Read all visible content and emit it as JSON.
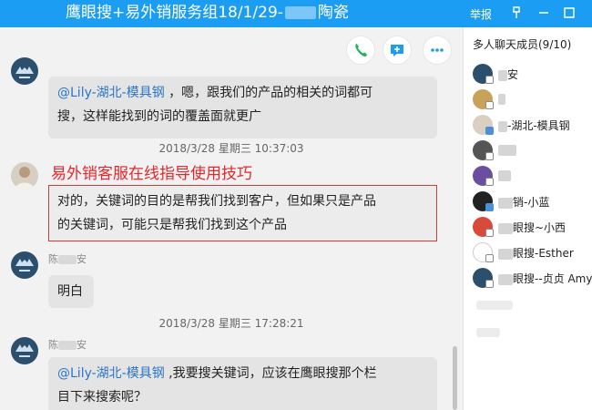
{
  "titlebar": {
    "title_prefix": "鹰眼搜+易外销服务组18/1/29-",
    "title_suffix": "陶瓷",
    "report": "举报",
    "pin_icon": "pin-icon",
    "minimize_icon": "minimize-icon",
    "maximize_icon": "maximize-icon"
  },
  "toolbar": {
    "call_icon": "phone-icon",
    "chat_icon": "chat-add-icon",
    "more_icon": "more-icon",
    "accent": "#1a9df2"
  },
  "messages": [
    {
      "mention": "@Lily-湖北-模具钢",
      "line1": " ，嗯，跟我们的产品的相关的词都可",
      "line2": "搜，这样能找到的词的覆盖面就更广"
    },
    {
      "timestamp": "2018/3/28 星期三 10:37:03"
    },
    {
      "caption": "易外销客服在线指导使用技巧",
      "line1": "对的，关键词的目的是帮我们找到客户，但如果只是产品",
      "line2": "的关键词，可能只是帮我们找到这个产品"
    },
    {
      "sender_prefix": "陈",
      "sender_suffix": "安",
      "text": "明白"
    },
    {
      "timestamp": "2018/3/28 星期三 17:28:21"
    },
    {
      "sender_prefix": "陈",
      "sender_suffix": "安",
      "mention": "@Lily-湖北-模具钢",
      "line1": " ,我要搜关键词，应该在鹰眼搜那个栏",
      "line2": "目下来搜索呢？"
    }
  ],
  "sidebar": {
    "title": "多人聊天成员(9/10)",
    "members": [
      {
        "name": "安"
      },
      {
        "name": ""
      },
      {
        "name": "-湖北-模具钢"
      },
      {
        "name": ""
      },
      {
        "name": ""
      },
      {
        "name": "销-小蓝"
      },
      {
        "name": "眼搜~小西"
      },
      {
        "name": "眼搜-Esther"
      },
      {
        "name": "眼搜--贞贞 Amy"
      }
    ]
  }
}
